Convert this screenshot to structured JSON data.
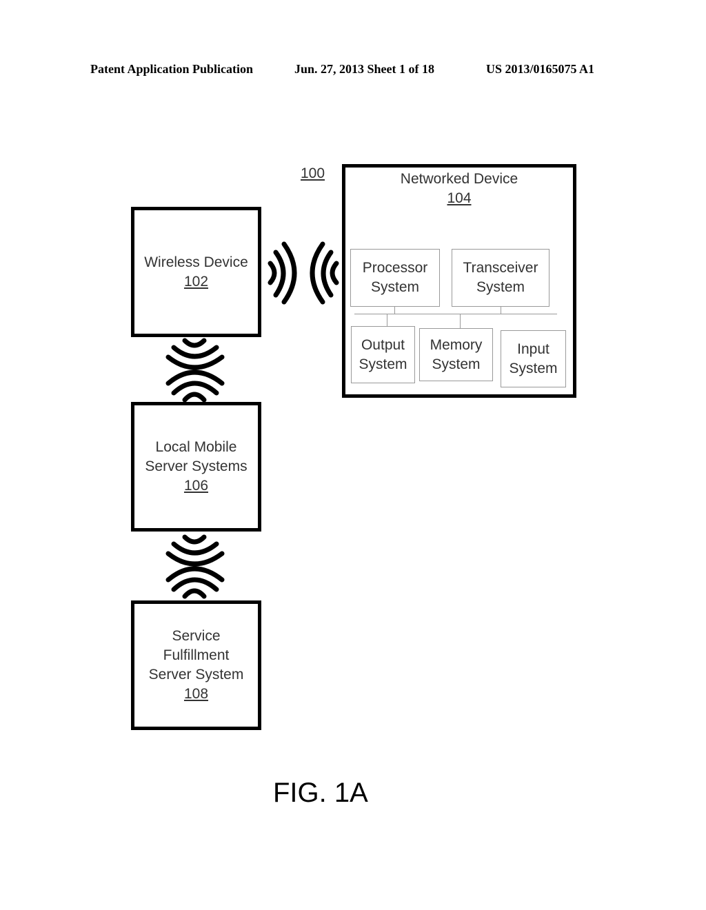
{
  "header": {
    "publication": "Patent Application Publication",
    "date_sheet": "Jun. 27, 2013  Sheet 1 of 18",
    "number": "US 2013/0165075 A1"
  },
  "diagram": {
    "system_ref": "100",
    "wireless_device": {
      "name": "Wireless Device",
      "ref": "102"
    },
    "networked_device": {
      "name": "Networked Device",
      "ref": "104",
      "components": {
        "processor": [
          "Processor",
          "System"
        ],
        "transceiver": [
          "Transceiver",
          "System"
        ],
        "output": [
          "Output",
          "System"
        ],
        "memory": [
          "Memory",
          "System"
        ],
        "input": [
          "Input",
          "System"
        ]
      }
    },
    "local_mobile": {
      "lines": [
        "Local Mobile",
        "Server Systems"
      ],
      "ref": "106"
    },
    "service_fulfillment": {
      "lines": [
        "Service",
        "Fulfillment",
        "Server System"
      ],
      "ref": "108"
    },
    "icons": [
      "wireless-signal-icon",
      "wireless-signal-icon",
      "wireless-signal-icon",
      "wireless-signal-icon"
    ]
  },
  "figure_label": "FIG. 1A"
}
